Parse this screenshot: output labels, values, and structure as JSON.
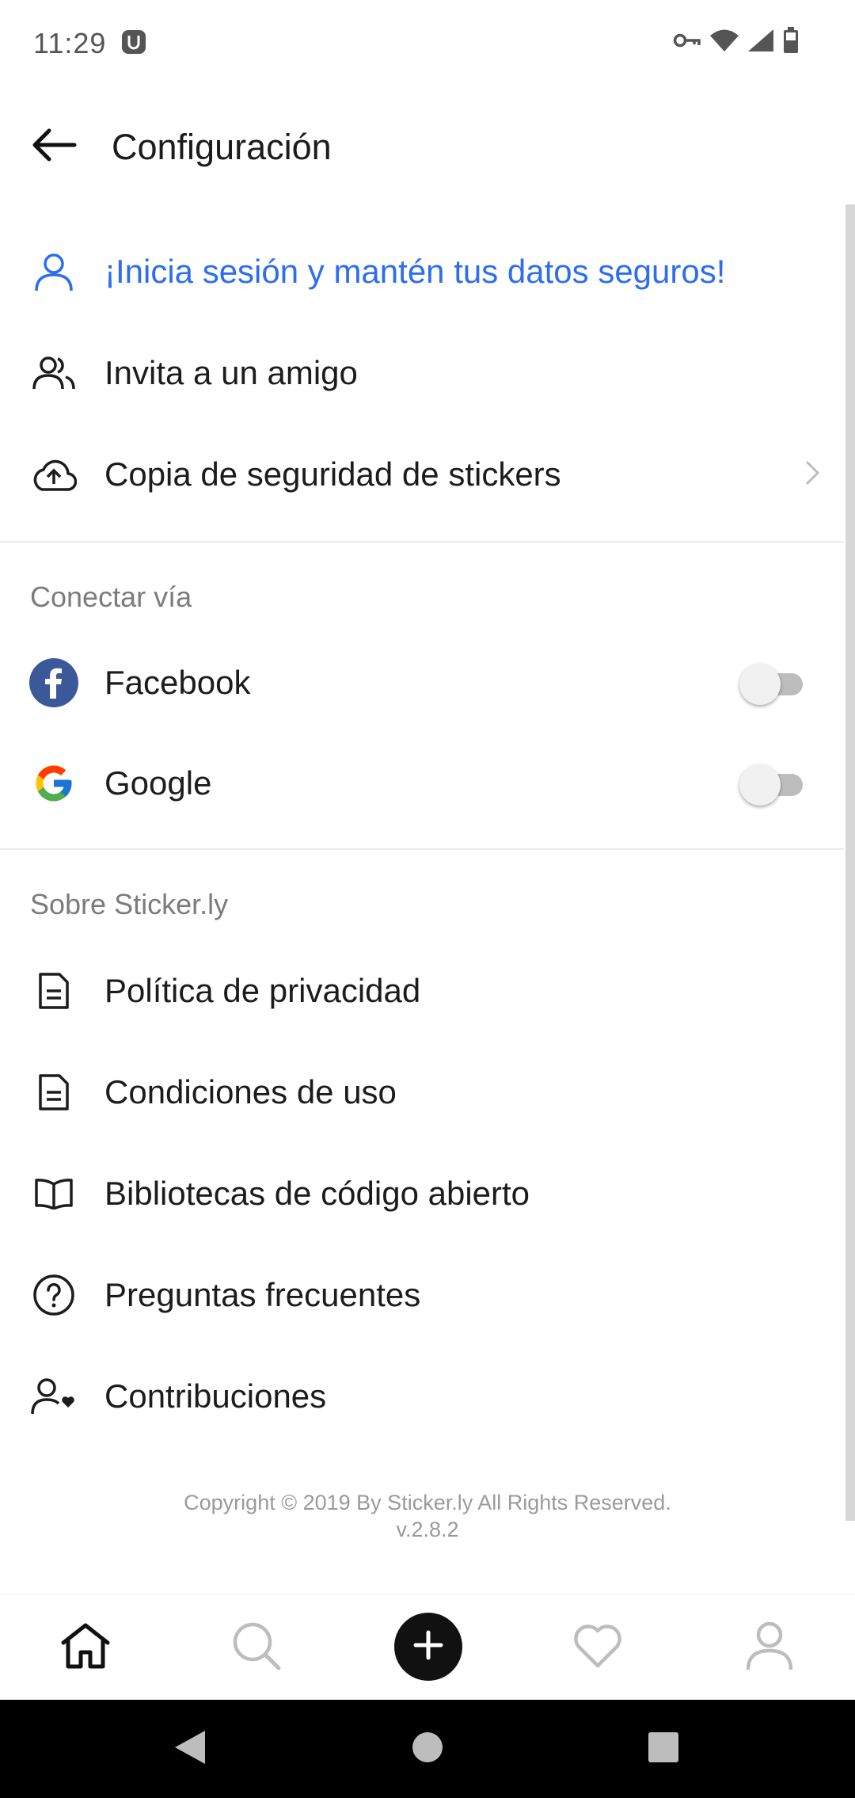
{
  "status_bar": {
    "time": "11:29",
    "icons": [
      "app-notification-icon",
      "vpn-key-icon",
      "wifi-icon",
      "signal-icon",
      "battery-icon"
    ]
  },
  "app_bar": {
    "title": "Configuración",
    "back_icon": "arrow-left-icon"
  },
  "account_items": [
    {
      "label": "¡Inicia sesión y mantén tus datos seguros!",
      "icon": "person-icon",
      "color": "#2d6df0"
    },
    {
      "label": "Invita a un amigo",
      "icon": "people-icon"
    },
    {
      "label": "Copia de seguridad de stickers",
      "icon": "cloud-upload-icon",
      "trailing": "chevron-right-icon"
    }
  ],
  "connect_section": {
    "header": "Conectar vía",
    "items": [
      {
        "label": "Facebook",
        "icon": "facebook-icon",
        "enabled": false,
        "color": "#3b5998"
      },
      {
        "label": "Google",
        "icon": "google-icon",
        "enabled": false
      }
    ]
  },
  "about_section": {
    "header": "Sobre Sticker.ly",
    "items": [
      {
        "label": "Política de privacidad",
        "icon": "document-icon"
      },
      {
        "label": "Condiciones de uso",
        "icon": "document-icon"
      },
      {
        "label": "Bibliotecas de código abierto",
        "icon": "book-icon"
      },
      {
        "label": "Preguntas frecuentes",
        "icon": "help-circle-icon"
      },
      {
        "label": "Contribuciones",
        "icon": "person-heart-icon"
      }
    ]
  },
  "footer": {
    "copyright": "Copyright © 2019 By Sticker.ly All Rights Reserved.",
    "version": "v.2.8.2"
  },
  "bottom_nav": {
    "items": [
      "home-icon",
      "search-icon",
      "add-icon",
      "heart-icon",
      "profile-icon"
    ],
    "active": "home-icon"
  },
  "system_nav": {
    "items": [
      "back-triangle-icon",
      "home-circle-icon",
      "recents-square-icon"
    ]
  }
}
